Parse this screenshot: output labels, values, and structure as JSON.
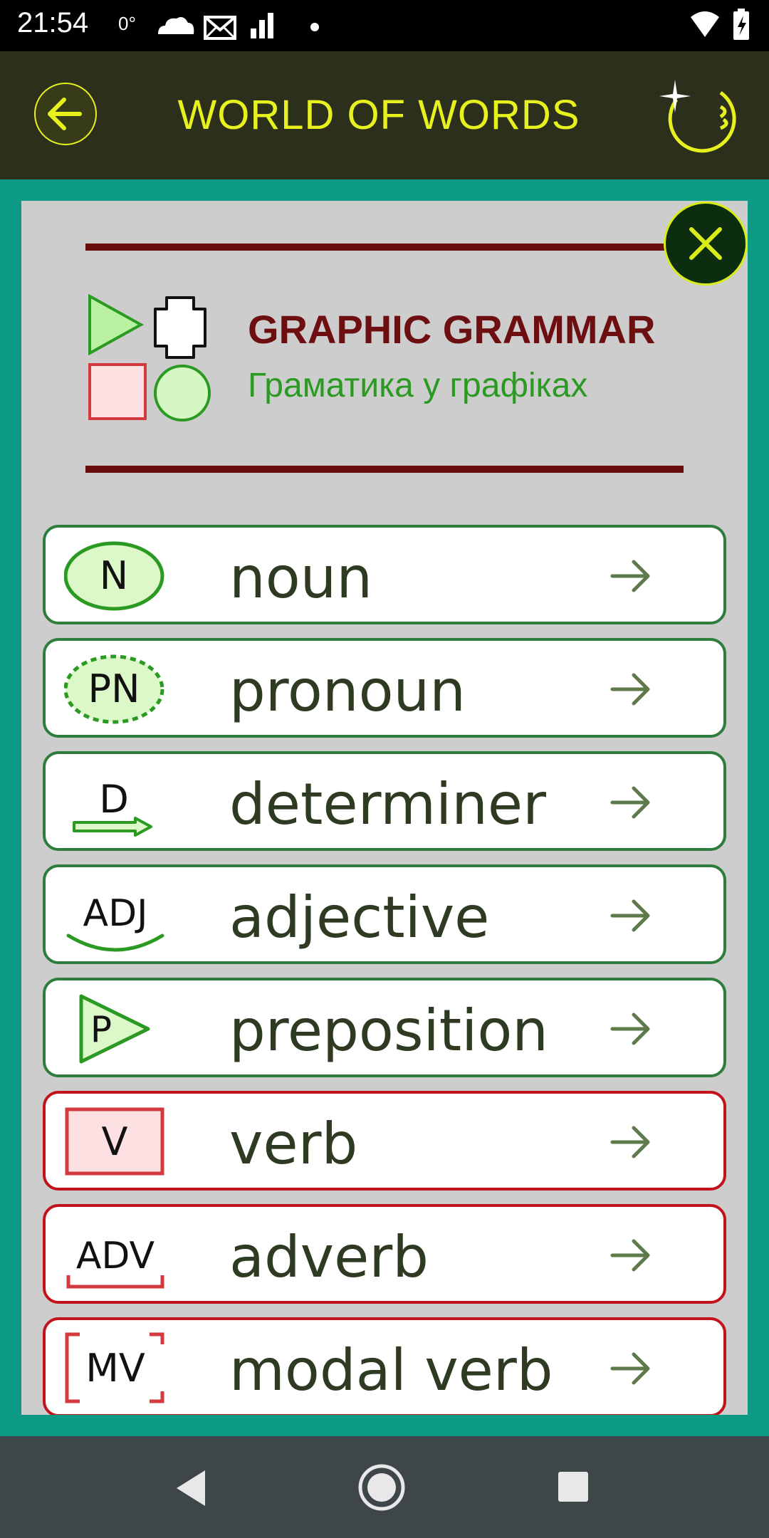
{
  "status_bar": {
    "time": "21:54",
    "temperature": "0°",
    "icons_left": [
      "cloud-icon",
      "mail-icon",
      "signal-bars-icon",
      "dot-icon"
    ],
    "icons_right": [
      "wifi-icon",
      "battery-charging-icon"
    ]
  },
  "app_bar": {
    "title": "WORLD OF WORDS",
    "back_icon": "arrow-left-icon",
    "logo_icon": "sparkle-logo-icon",
    "accent_color": "#e6f11e"
  },
  "panel": {
    "title": "GRAPHIC GRAMMAR",
    "subtitle": "Граматика у графіках",
    "close_icon": "close-icon"
  },
  "items": [
    {
      "label": "noun",
      "symbol": "N",
      "group": "green"
    },
    {
      "label": "pronoun",
      "symbol": "PN",
      "group": "green"
    },
    {
      "label": "determiner",
      "symbol": "D",
      "group": "green"
    },
    {
      "label": "adjective",
      "symbol": "ADJ",
      "group": "green"
    },
    {
      "label": "preposition",
      "symbol": "P",
      "group": "green"
    },
    {
      "label": "verb",
      "symbol": "V",
      "group": "red"
    },
    {
      "label": "adverb",
      "symbol": "ADV",
      "group": "red"
    },
    {
      "label": "modal verb",
      "symbol": "MV",
      "group": "red"
    }
  ],
  "colors": {
    "green_border": "#2e7d3d",
    "red_border": "#c2121a",
    "frame": "#0e9b85",
    "panel": "#cdcdcd",
    "title": "#6d0f11",
    "subtitle": "#2b9a22"
  },
  "nav_bar": {
    "icons": [
      "back-triangle-icon",
      "home-circle-icon",
      "recents-square-icon"
    ]
  }
}
